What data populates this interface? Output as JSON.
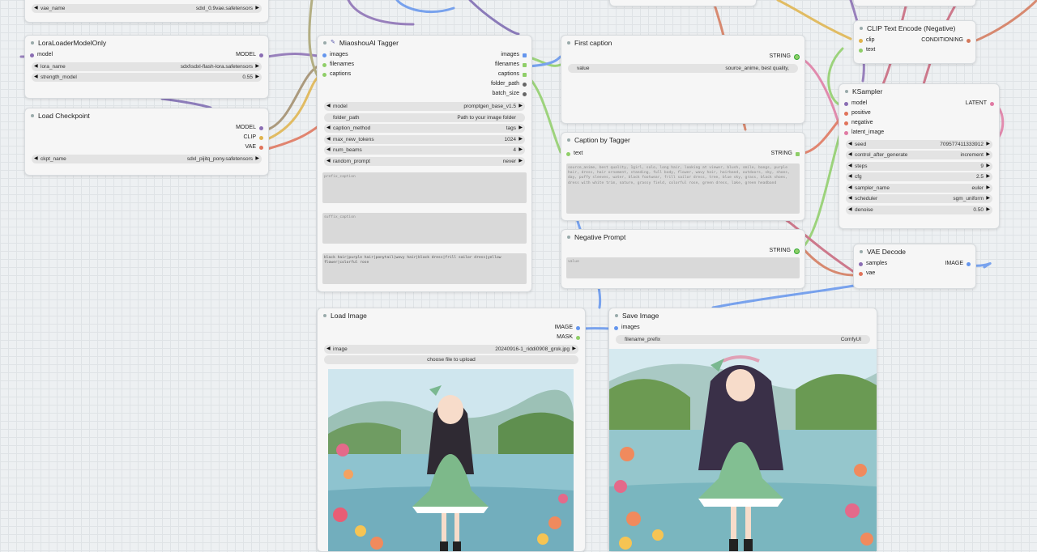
{
  "colors": {
    "model_port": "#8a6db3",
    "clip_port": "#e0b34b",
    "vae_port": "#e0735a",
    "string_port": "#8fce68",
    "image_port": "#6495ed",
    "conditioning_port": "#d4785a",
    "latent_port": "#e07aa3",
    "grey_port": "#666666"
  },
  "nodes": {
    "vae_loader": {
      "vae_name_label": "vae_name",
      "vae_name_value": "sdxl_0.9vae.safetensors"
    },
    "lora": {
      "title": "LoraLoaderModelOnly",
      "in_model": "model",
      "out_model": "MODEL",
      "lora_name_label": "lora_name",
      "lora_name_value": "sdxl\\sdxl-flash-lora.safetensors",
      "strength_label": "strength_model",
      "strength_value": "0.55"
    },
    "checkpoint": {
      "title": "Load Checkpoint",
      "out_model": "MODEL",
      "out_clip": "CLIP",
      "out_vae": "VAE",
      "ckpt_label": "ckpt_name",
      "ckpt_value": "sdxl_pijitq_pony.safetensors"
    },
    "tagger": {
      "title": "MiaoshouAI Tagger",
      "in_images": "images",
      "in_filenames": "filenames",
      "in_captions": "captions",
      "out_images": "images",
      "out_filenames": "filenames",
      "out_captions": "captions",
      "out_folder_path": "folder_path",
      "out_batch_size": "batch_size",
      "widgets": [
        {
          "label": "model",
          "value": "promptgen_base_v1.5",
          "arrows": true
        },
        {
          "label": "folder_path",
          "value": "Path to your image folder",
          "arrows": false
        },
        {
          "label": "caption_method",
          "value": "tags",
          "arrows": true
        },
        {
          "label": "max_new_tokens",
          "value": "1024",
          "arrows": true
        },
        {
          "label": "num_beams",
          "value": "4",
          "arrows": true
        },
        {
          "label": "random_prompt",
          "value": "never",
          "arrows": true
        }
      ],
      "prefix_placeholder": "prefix_caption",
      "suffix_placeholder": "suffix_caption",
      "tags_text": "black hair|purple hair|ponytail|wavy hair|black dress|frill sailor dress|yellow flower|colorful rose"
    },
    "first_caption": {
      "title": "First caption",
      "out_string": "STRING",
      "value_label": "value",
      "value_value": "source_anime, best quality,"
    },
    "caption_tagger": {
      "title": "Caption by Tagger",
      "in_text": "text",
      "out_string": "STRING",
      "text": "source_anime, best quality, 1girl, solo, long hair, looking at viewer, blush, smile, bangs, purple hair, dress, hair ornament, standing, full body, flower, wavy hair, hairband, outdoors, sky, shoes, day, puffy sleeves, water, black footwear, frill sailor dress, tree, blue sky, grass, black shoes, dress with white trim, nature, grassy field, colorful rose, green dress, lake, green headband"
    },
    "negative_prompt": {
      "title": "Negative Prompt",
      "out_string": "STRING",
      "placeholder": "value"
    },
    "clip_negative": {
      "title": "CLIP Text Encode (Negative)",
      "in_clip": "clip",
      "in_text": "text",
      "out_cond": "CONDITIONING"
    },
    "ksampler": {
      "title": "KSampler",
      "in_model": "model",
      "in_positive": "positive",
      "in_negative": "negative",
      "in_latent": "latent_image",
      "out_latent": "LATENT",
      "widgets": [
        {
          "label": "seed",
          "value": "709577411333912"
        },
        {
          "label": "control_after_generate",
          "value": "increment"
        },
        {
          "label": "steps",
          "value": "9"
        },
        {
          "label": "cfg",
          "value": "2.5"
        },
        {
          "label": "sampler_name",
          "value": "euler"
        },
        {
          "label": "scheduler",
          "value": "sgm_uniform"
        },
        {
          "label": "denoise",
          "value": "0.50"
        }
      ]
    },
    "vae_decode": {
      "title": "VAE Decode",
      "in_samples": "samples",
      "in_vae": "vae",
      "out_image": "IMAGE"
    },
    "load_image": {
      "title": "Load Image",
      "out_image": "IMAGE",
      "out_mask": "MASK",
      "image_label": "image",
      "image_value": "20240916-1_riddi0908_grok.jpg",
      "upload_label": "choose file to upload"
    },
    "save_image": {
      "title": "Save Image",
      "in_images": "images",
      "prefix_label": "filename_prefix",
      "prefix_value": "ComfyUI"
    }
  }
}
